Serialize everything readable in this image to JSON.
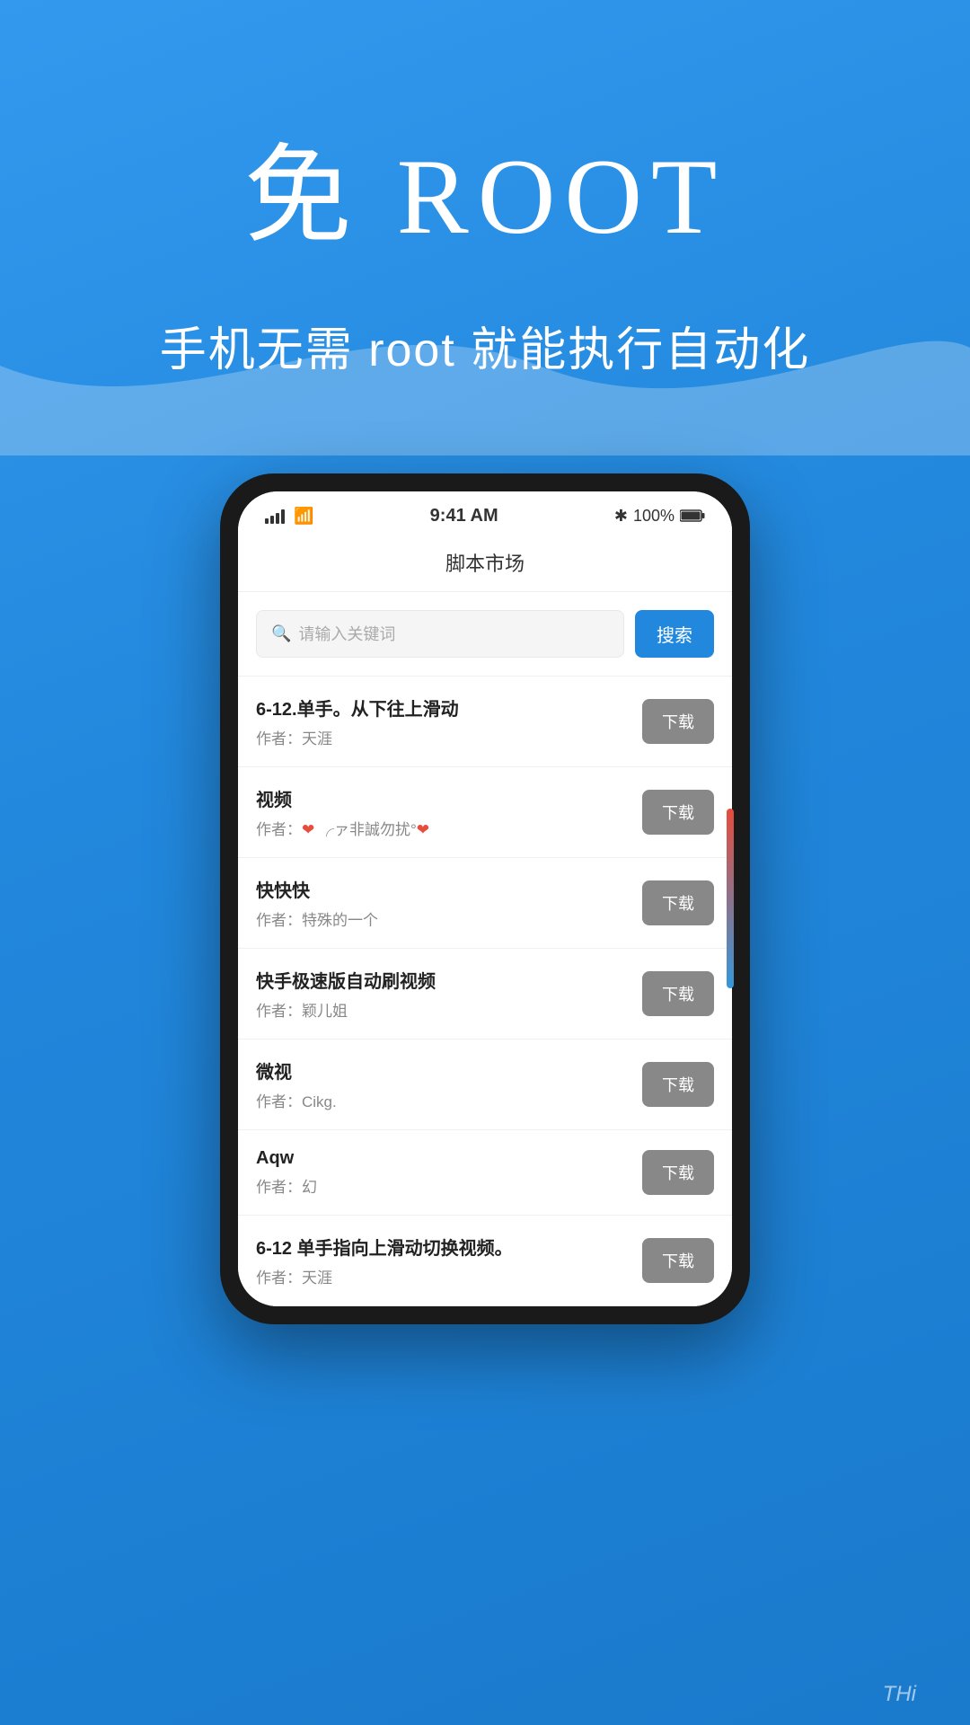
{
  "hero": {
    "title": "免 ROOT",
    "subtitle": "手机无需 root 就能执行自动化"
  },
  "status_bar": {
    "time": "9:41 AM",
    "battery": "100%",
    "bluetooth": "✱"
  },
  "app_header": {
    "title": "脚本市场"
  },
  "search": {
    "placeholder": "请输入关键词",
    "button_label": "搜索"
  },
  "scripts": [
    {
      "name": "6-12.单手。从下往上滑动",
      "author_prefix": "作者：",
      "author": "天涯",
      "author_colored": false
    },
    {
      "name": "视频",
      "author_prefix": "作者：",
      "author": "❤ ╭ァ非誠勿扰°❤",
      "author_colored": true
    },
    {
      "name": "快快快",
      "author_prefix": "作者：",
      "author": "特殊的一个",
      "author_colored": false
    },
    {
      "name": "快手极速版自动刷视频",
      "author_prefix": "作者：",
      "author": "颖儿姐",
      "author_colored": false
    },
    {
      "name": "微视",
      "author_prefix": "作者：",
      "author": "Cikg.",
      "author_colored": false
    },
    {
      "name": "Aqw",
      "author_prefix": "作者：",
      "author": "幻",
      "author_colored": false
    },
    {
      "name": "6-12 单手指向上滑动切换视频。",
      "author_prefix": "作者：",
      "author": "天涯",
      "author_colored": false,
      "partial": true
    }
  ],
  "download_label": "下载",
  "watermark": "THi"
}
